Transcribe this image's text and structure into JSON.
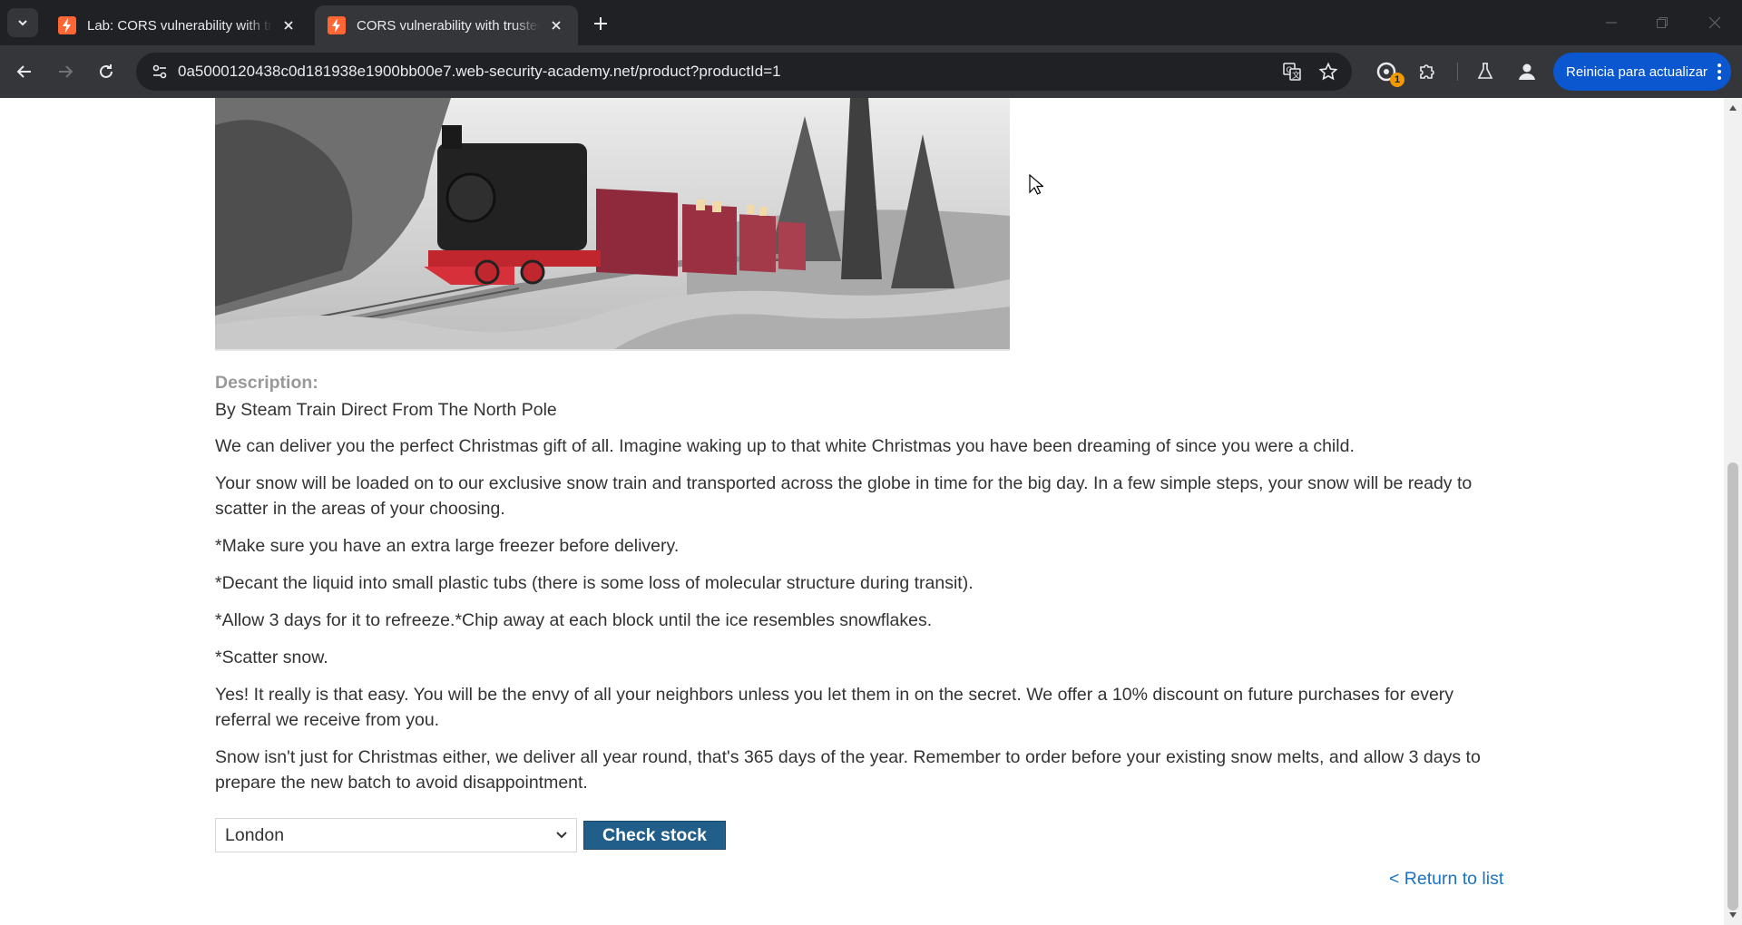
{
  "browser": {
    "tabs": [
      {
        "title": "Lab: CORS vulnerability with trusted insecure protocols",
        "active": false
      },
      {
        "title": "CORS vulnerability with trusted insecure protocols",
        "active": true
      }
    ],
    "url": "0a5000120438c0d181938e1900bb00e7.web-security-academy.net/product?productId=1",
    "extension_badge": "1",
    "update_button_label": "Reinicia para actualizar",
    "accent_color": "#0b57d0",
    "favicon_color": "#ff6633"
  },
  "product": {
    "description_label": "Description:",
    "tagline": "By Steam Train Direct From The North Pole",
    "paragraphs": [
      "We can deliver you the perfect Christmas gift of all. Imagine waking up to that white Christmas you have been dreaming of since you were a child.",
      "Your snow will be loaded on to our exclusive snow train and transported across the globe in time for the big day. In a few simple steps, your snow will be ready to scatter in the areas of your choosing.",
      "*Make sure you have an extra large freezer before delivery.",
      "*Decant the liquid into small plastic tubs (there is some loss of molecular structure during transit).",
      "*Allow 3 days for it to refreeze.*Chip away at each block until the ice resembles snowflakes.",
      "*Scatter snow.",
      "Yes! It really is that easy. You will be the envy of all your neighbors unless you let them in on the secret. We offer a 10% discount on future purchases for every referral we receive from you.",
      "Snow isn't just for Christmas either, we deliver all year round, that's 365 days of the year. Remember to order before your existing snow melts, and allow 3 days to prepare the new batch to avoid disappointment."
    ]
  },
  "stock": {
    "selected_store": "London",
    "check_button_label": "Check stock",
    "button_color": "#215f8a"
  },
  "return_link": "< Return to list"
}
